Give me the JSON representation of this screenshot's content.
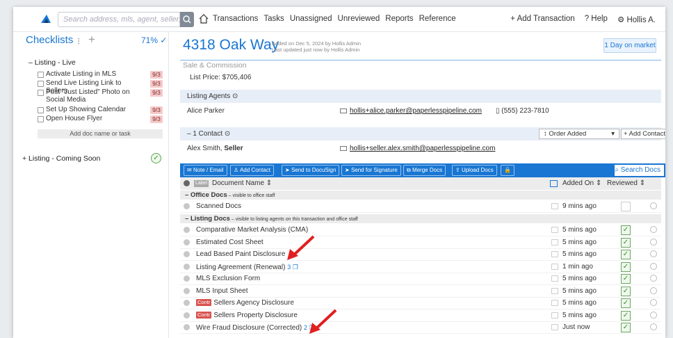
{
  "topbar": {
    "search_placeholder": "Search address, mls, agent, seller, buyer",
    "nav": [
      "Transactions",
      "Tasks",
      "Unassigned",
      "Unreviewed",
      "Reports",
      "Reference"
    ],
    "add_transaction": "+ Add Transaction",
    "help": "? Help",
    "user": "Hollis A."
  },
  "sidebar": {
    "title": "Checklists",
    "percent": "71%",
    "group1": "– Listing - Live",
    "items": [
      {
        "label": "Activate Listing in MLS",
        "count": "9/3"
      },
      {
        "label": "Send Live Listing Link to Sellers",
        "count": "9/3"
      },
      {
        "label": "Post \"Just Listed\" Photo on Social Media",
        "count": "9/3"
      },
      {
        "label": "Set Up Showing Calendar",
        "count": "9/3"
      },
      {
        "label": "Open House Flyer",
        "count": "9/3"
      }
    ],
    "add_doc": "Add doc name or task",
    "group2": "+ Listing - Coming Soon"
  },
  "header": {
    "address": "4318 Oak Way",
    "added": "Added on Dec 5, 2024 by Hollis Admin",
    "updated": "Last updated just now by Hollis Admin",
    "days_on_market": "1 Day on market"
  },
  "sale": {
    "section": "Sale & Commission",
    "list_price": "List Price:  $705,406"
  },
  "agents": {
    "header": "Listing Agents ⊙",
    "name": "Alice Parker",
    "email": "hollis+alice.parker@paperlesspipeline.com",
    "phone": "(555) 223-7810"
  },
  "contacts": {
    "header": "– 1 Contact ⊙",
    "order": "↕ Order Added",
    "add_contact": "+ Add Contact",
    "name": "Alex Smith, ",
    "role": "Seller",
    "email": "hollis+seller.alex.smith@paperlesspipeline.com"
  },
  "toolbar": {
    "buttons": [
      "Note / Email",
      "Add Contact",
      "Send to DocuSign",
      "Send for Signature",
      "Merge Docs",
      "Upload Docs"
    ],
    "search_docs": "Search Docs"
  },
  "table": {
    "label_tag": "Label",
    "col_name": "Document Name ⇕",
    "col_added": "Added On ⇕",
    "col_reviewed": "Reviewed ⇕",
    "office_section": "Office Docs",
    "office_note": " – visible to office staff",
    "listing_section": "Listing Docs",
    "listing_note": " – visible to listing agents on this transaction and office staff",
    "office_rows": [
      {
        "name": "Scanned Docs",
        "added": "9 mins ago",
        "reviewed": false
      }
    ],
    "listing_rows": [
      {
        "name": "Comparative Market Analysis (CMA)",
        "added": "5 mins ago",
        "reviewed": true
      },
      {
        "name": "Estimated Cost Sheet",
        "added": "5 mins ago",
        "reviewed": true
      },
      {
        "name": "Lead Based Paint Disclosure",
        "added": "5 mins ago",
        "reviewed": true
      },
      {
        "name": "Listing Agreement (Renewal)",
        "versions": "3",
        "added": "1 min ago",
        "reviewed": true
      },
      {
        "name": "MLS Exclusion Form",
        "added": "5 mins ago",
        "reviewed": true
      },
      {
        "name": "MLS Input Sheet",
        "added": "5 mins ago",
        "reviewed": true
      },
      {
        "name": "Sellers Agency Disclosure",
        "tag": "Contr",
        "added": "5 mins ago",
        "reviewed": true
      },
      {
        "name": "Sellers Property Disclosure",
        "tag": "Contr",
        "added": "5 mins ago",
        "reviewed": true
      },
      {
        "name": "Wire Fraud Disclosure (Corrected)",
        "versions": "2",
        "added": "Just now",
        "reviewed": true
      }
    ]
  }
}
